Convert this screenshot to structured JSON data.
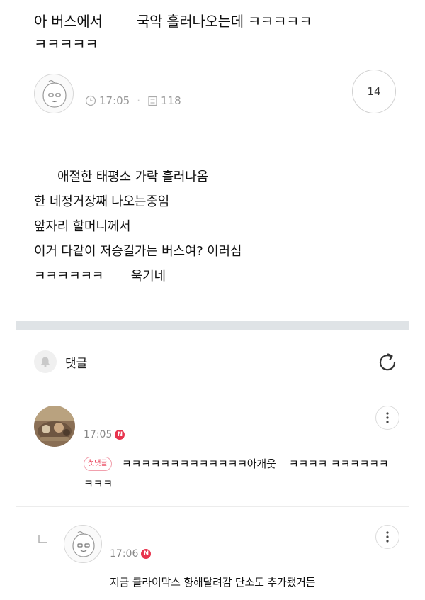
{
  "post": {
    "title": "아 버스에서        국악 흘러나오는데 ㅋㅋㅋㅋㅋ\nㅋㅋㅋㅋㅋ",
    "time": "17:05",
    "views": "118",
    "comment_count": "14",
    "body": "      애절한 태평소 가락 흘러나옴\n한 네정거장째 나오는중임\n앞자리 할머니께서\n이거 다같이 저승길가는 버스여? 이러심\nㅋㅋㅋㅋㅋㅋ       욱기네"
  },
  "comments_section": {
    "label": "댓글"
  },
  "comments": [
    {
      "time": "17:05",
      "new_badge": "N",
      "first_badge": "첫댓글",
      "text": "ㅋㅋㅋㅋㅋㅋㅋㅋㅋㅋㅋㅋㅋ아개웃    ㅋㅋㅋㅋ ㅋㅋㅋㅋㅋㅋㅋㅋㅋ"
    },
    {
      "time": "17:06",
      "new_badge": "N",
      "text": "지금 클라이막스 향해달려감 단소도 추가됐거든"
    }
  ],
  "colors": {
    "accent_red": "#e8344e",
    "divider_band": "#dfe3e6",
    "meta_gray": "#9a9a9a"
  },
  "icons": {
    "author_avatar": "peach-face-icon",
    "time": "clock-icon",
    "views": "document-icon",
    "comment_header": "bell-icon",
    "refresh": "refresh-icon",
    "more": "more-vertical-icon",
    "reply": "reply-arrow-icon"
  }
}
